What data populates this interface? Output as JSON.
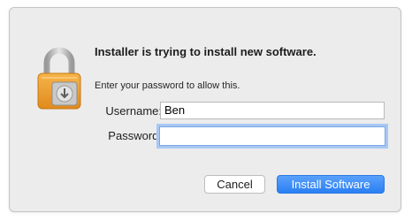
{
  "dialog": {
    "title": "Installer is trying to install new software.",
    "subtitle": "Enter your password to allow this.",
    "icon": "lock-installer-icon"
  },
  "form": {
    "username_label": "Username:",
    "username_value": "Ben",
    "password_label": "Password:",
    "password_value": ""
  },
  "buttons": {
    "cancel_label": "Cancel",
    "install_label": "Install Software"
  },
  "colors": {
    "accent": "#2a7ff3",
    "focus_ring": "#a8c8f3",
    "lock_gold": "#f0a431"
  }
}
